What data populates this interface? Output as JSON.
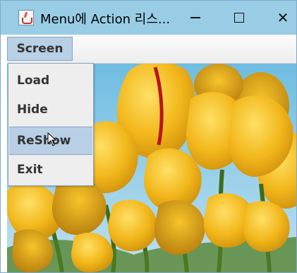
{
  "window": {
    "title": "Menu에 Action 리스...",
    "minimize_icon": "minimize-icon",
    "maximize_icon": "maximize-icon",
    "close_icon": "close-icon",
    "close_glyph": "✕"
  },
  "menubar": {
    "menus": [
      {
        "label": "Screen"
      }
    ]
  },
  "popup_menu": {
    "items": [
      {
        "label": "Load"
      },
      {
        "label": "Hide"
      },
      {
        "label": "ReShow",
        "highlighted": true
      },
      {
        "label": "Exit"
      }
    ]
  },
  "content": {
    "image_subject": "yellow tulips with green stems against a blue sky"
  },
  "colors": {
    "titlebar": "#99cde6",
    "menu_highlight": "#b8cfe5",
    "menu_border": "#8aa6c3",
    "popup_background": "#eeeeee",
    "tulip_yellow": "#f0b51a",
    "stem_green": "#3d6b1f",
    "sky_blue": "#6fbde2"
  }
}
